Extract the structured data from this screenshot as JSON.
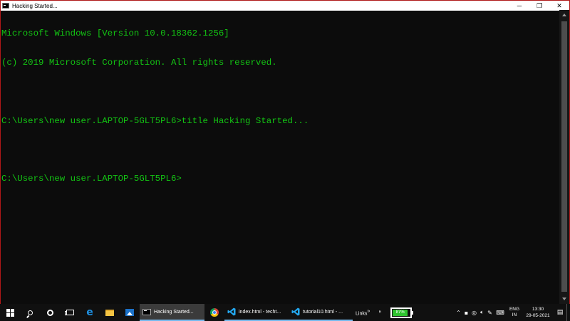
{
  "window": {
    "title": "Hacking Started...",
    "buttons": {
      "minimize": "─",
      "maximize": "❐",
      "close": "✕"
    }
  },
  "console": {
    "text_color": "#13c413",
    "lines": [
      "Microsoft Windows [Version 10.0.18362.1256]",
      "(c) 2019 Microsoft Corporation. All rights reserved.",
      "",
      "C:\\Users\\new user.LAPTOP-5GLT5PL6>title Hacking Started...",
      "",
      "C:\\Users\\new user.LAPTOP-5GLT5PL6>"
    ]
  },
  "taskbar": {
    "pinned": [
      "windows-start-icon",
      "search-icon",
      "cortana-icon",
      "task-view-icon",
      "edge-icon",
      "file-explorer-icon",
      "photos-icon"
    ],
    "tasks": [
      {
        "label": "Hacking Started...",
        "icon": "cmd-icon",
        "state": "active"
      },
      {
        "label": "",
        "icon": "chrome-icon",
        "state": "pinned"
      },
      {
        "label": "index.html - techt...",
        "icon": "vscode-icon",
        "state": "open"
      },
      {
        "label": "tutorial10.html - ...",
        "icon": "vscode-icon",
        "state": "open"
      }
    ],
    "links_label": "Links",
    "links_chevron": "»",
    "battery": {
      "percent_label": "87%",
      "level": 0.87,
      "color": "#2fc42f"
    },
    "tray": {
      "language": {
        "code": "ENG",
        "region": "IN"
      },
      "time": "13:30",
      "date": "29-05-2021"
    }
  }
}
